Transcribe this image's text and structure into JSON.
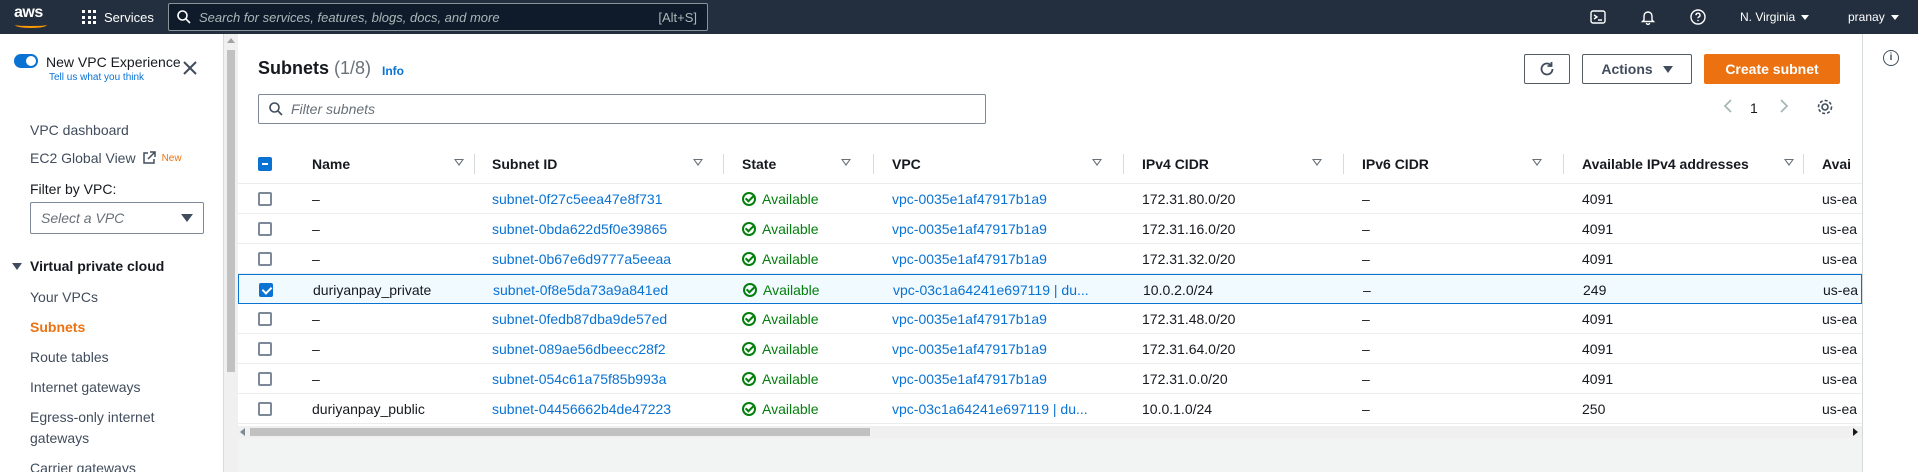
{
  "topnav": {
    "logo": "aws",
    "services_label": "Services",
    "search_placeholder": "Search for services, features, blogs, docs, and more",
    "search_shortcut": "[Alt+S]",
    "region": "N. Virginia",
    "user": "pranay"
  },
  "sidebar": {
    "new_vpc_title": "New VPC Experience",
    "new_vpc_tell": "Tell us what you think",
    "links": {
      "vpc_dashboard": "VPC dashboard",
      "ec2_global_view": "EC2 Global View",
      "new_badge": "New"
    },
    "filter_label": "Filter by VPC:",
    "filter_placeholder": "Select a VPC",
    "section_title": "Virtual private cloud",
    "items": [
      "Your VPCs",
      "Subnets",
      "Route tables",
      "Internet gateways",
      "Egress-only internet",
      "gateways",
      "Carrier gateways"
    ]
  },
  "main": {
    "title": "Subnets",
    "count": "(1/8)",
    "info": "Info",
    "actions_label": "Actions",
    "create_label": "Create subnet",
    "filter_placeholder": "Filter subnets",
    "page_number": "1"
  },
  "table": {
    "columns": [
      "Name",
      "Subnet ID",
      "State",
      "VPC",
      "IPv4 CIDR",
      "IPv6 CIDR",
      "Available IPv4 addresses",
      "Avai"
    ],
    "rows": [
      {
        "selected": false,
        "name": "–",
        "subnet_id": "subnet-0f27c5eea47e8f731",
        "state": "Available",
        "vpc": "vpc-0035e1af47917b1a9",
        "ipv4": "172.31.80.0/20",
        "ipv6": "–",
        "avail": "4091",
        "az": "us-ea"
      },
      {
        "selected": false,
        "name": "–",
        "subnet_id": "subnet-0bda622d5f0e39865",
        "state": "Available",
        "vpc": "vpc-0035e1af47917b1a9",
        "ipv4": "172.31.16.0/20",
        "ipv6": "–",
        "avail": "4091",
        "az": "us-ea"
      },
      {
        "selected": false,
        "name": "–",
        "subnet_id": "subnet-0b67e6d9777a5eeaa",
        "state": "Available",
        "vpc": "vpc-0035e1af47917b1a9",
        "ipv4": "172.31.32.0/20",
        "ipv6": "–",
        "avail": "4091",
        "az": "us-ea"
      },
      {
        "selected": true,
        "name": "duriyanpay_private",
        "subnet_id": "subnet-0f8e5da73a9a841ed",
        "state": "Available",
        "vpc": "vpc-03c1a64241e697119 | du...",
        "ipv4": "10.0.2.0/24",
        "ipv6": "–",
        "avail": "249",
        "az": "us-ea"
      },
      {
        "selected": false,
        "name": "–",
        "subnet_id": "subnet-0fedb87dba9de57ed",
        "state": "Available",
        "vpc": "vpc-0035e1af47917b1a9",
        "ipv4": "172.31.48.0/20",
        "ipv6": "–",
        "avail": "4091",
        "az": "us-ea"
      },
      {
        "selected": false,
        "name": "–",
        "subnet_id": "subnet-089ae56dbeecc28f2",
        "state": "Available",
        "vpc": "vpc-0035e1af47917b1a9",
        "ipv4": "172.31.64.0/20",
        "ipv6": "–",
        "avail": "4091",
        "az": "us-ea"
      },
      {
        "selected": false,
        "name": "–",
        "subnet_id": "subnet-054c61a75f85b993a",
        "state": "Available",
        "vpc": "vpc-0035e1af47917b1a9",
        "ipv4": "172.31.0.0/20",
        "ipv6": "–",
        "avail": "4091",
        "az": "us-ea"
      },
      {
        "selected": false,
        "name": "duriyanpay_public",
        "subnet_id": "subnet-04456662b4de47223",
        "state": "Available",
        "vpc": "vpc-03c1a64241e697119 | du...",
        "ipv4": "10.0.1.0/24",
        "ipv6": "–",
        "avail": "250",
        "az": "us-ea"
      }
    ]
  }
}
